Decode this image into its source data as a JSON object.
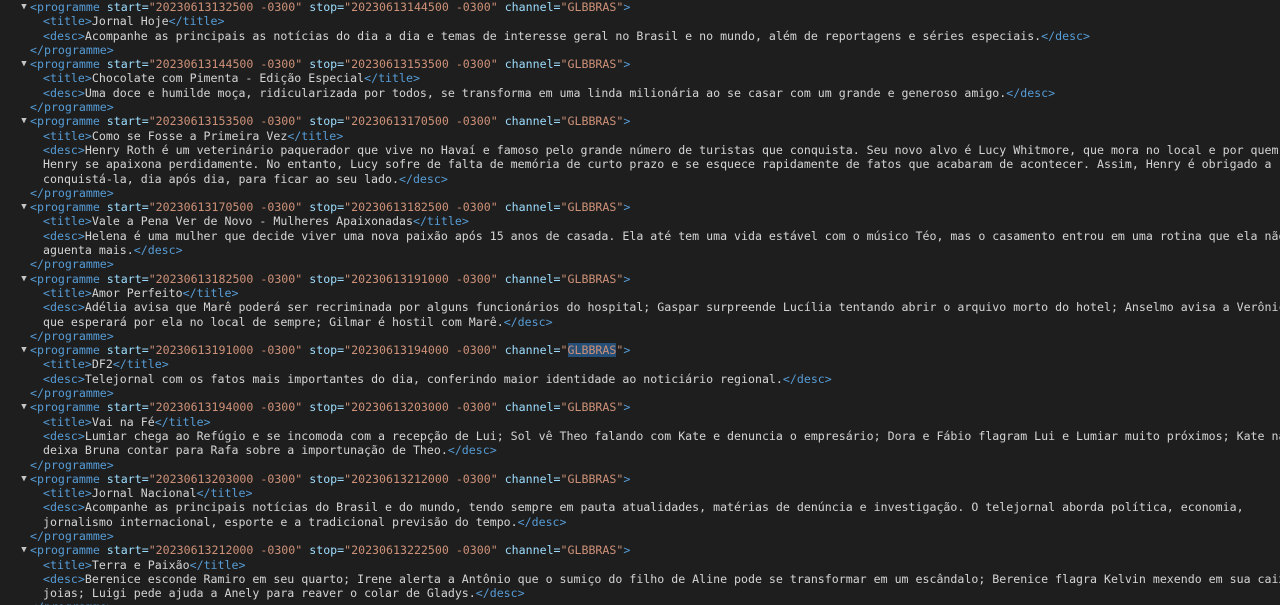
{
  "xml": {
    "open_tag": "<programme",
    "attr_start": "start=",
    "attr_stop": "stop=",
    "attr_channel": "channel=",
    "open_end": ">",
    "close_programme": "</programme>",
    "title_open": "<title>",
    "title_close": "</title>",
    "desc_open": "<desc>",
    "desc_close": "</desc>"
  },
  "programmes": [
    {
      "start": "\"20230613132500 -0300\"",
      "stop": "\"20230613144500 -0300\"",
      "channel": "GLBBRAS",
      "title": "Jornal Hoje",
      "desc": [
        "Acompanhe as principais as notícias do dia a dia e temas de interesse geral no Brasil e no mundo, além de reportagens e séries especiais."
      ]
    },
    {
      "start": "\"20230613144500 -0300\"",
      "stop": "\"20230613153500 -0300\"",
      "channel": "GLBBRAS",
      "title": "Chocolate com Pimenta - Edição Especial",
      "desc": [
        "Uma doce e humilde moça, ridicularizada por todos, se transforma em uma linda milionária ao se casar com um grande e generoso amigo."
      ]
    },
    {
      "start": "\"20230613153500 -0300\"",
      "stop": "\"20230613170500 -0300\"",
      "channel": "GLBBRAS",
      "title": "Como se Fosse a Primeira Vez",
      "desc": [
        "Henry Roth é um veterinário paquerador que vive no Havaí e famoso pelo grande número de turistas que conquista. Seu novo alvo é Lucy Whitmore, que mora no local e por quem",
        "Henry se apaixona perdidamente. No entanto, Lucy sofre de falta de memória de curto prazo e se esquece rapidamente de fatos que acabaram de acontecer. Assim, Henry é obrigado a",
        "conquistá-la, dia após dia, para ficar ao seu lado."
      ]
    },
    {
      "start": "\"20230613170500 -0300\"",
      "stop": "\"20230613182500 -0300\"",
      "channel": "GLBBRAS",
      "title": "Vale a Pena Ver de Novo - Mulheres Apaixonadas",
      "desc": [
        "Helena é uma mulher que decide viver uma nova paixão após 15 anos de casada. Ela até tem uma vida estável com o músico Téo, mas o casamento entrou em uma rotina que ela não",
        "aguenta mais."
      ]
    },
    {
      "start": "\"20230613182500 -0300\"",
      "stop": "\"20230613191000 -0300\"",
      "channel": "GLBBRAS",
      "title": "Amor Perfeito",
      "desc": [
        "Adélia avisa que Marê poderá ser recriminada por alguns funcionários do hospital; Gaspar surpreende Lucília tentando abrir o arquivo morto do hotel; Anselmo avisa a Verônica",
        "que esperará por ela no local de sempre; Gilmar é hostil com Marê."
      ]
    },
    {
      "start": "\"20230613191000 -0300\"",
      "stop": "\"20230613194000 -0300\"",
      "channel": "GLBBRAS",
      "title": "DF2",
      "desc": [
        "Telejornal com os fatos mais importantes do dia, conferindo maior identidade ao noticiário regional."
      ]
    },
    {
      "start": "\"20230613194000 -0300\"",
      "stop": "\"20230613203000 -0300\"",
      "channel": "GLBBRAS",
      "title": "Vai na Fé",
      "desc": [
        "Lumiar chega ao Refúgio e se incomoda com a recepção de Lui; Sol vê Theo falando com Kate e denuncia o empresário; Dora e Fábio flagram Lui e Lumiar muito próximos; Kate não",
        "deixa Bruna contar para Rafa sobre a importunação de Theo."
      ]
    },
    {
      "start": "\"20230613203000 -0300\"",
      "stop": "\"20230613212000 -0300\"",
      "channel": "GLBBRAS",
      "title": "Jornal Nacional",
      "desc": [
        "Acompanhe as principais notícias do Brasil e do mundo, tendo sempre em pauta atualidades, matérias de denúncia e investigação. O telejornal aborda política, economia,",
        "jornalismo internacional, esporte e a tradicional previsão do tempo."
      ]
    },
    {
      "start": "\"20230613212000 -0300\"",
      "stop": "\"20230613222500 -0300\"",
      "channel": "GLBBRAS",
      "title": "Terra e Paixão",
      "desc": [
        "Berenice esconde Ramiro em seu quarto; Irene alerta a Antônio que o sumiço do filho de Aline pode se transformar em um escândalo; Berenice flagra Kelvin mexendo em sua caixa de",
        "joias; Luigi pede ajuda a Anely para reaver o colar de Gladys."
      ]
    }
  ],
  "selection": {
    "programme_index": 5,
    "field": "channel"
  },
  "colors": {
    "background": "#1e1e1e",
    "tag": "#569cd6",
    "attribute": "#9cdcfe",
    "value": "#ce9178",
    "text": "#d4d4d4",
    "selection": "#264f78"
  }
}
